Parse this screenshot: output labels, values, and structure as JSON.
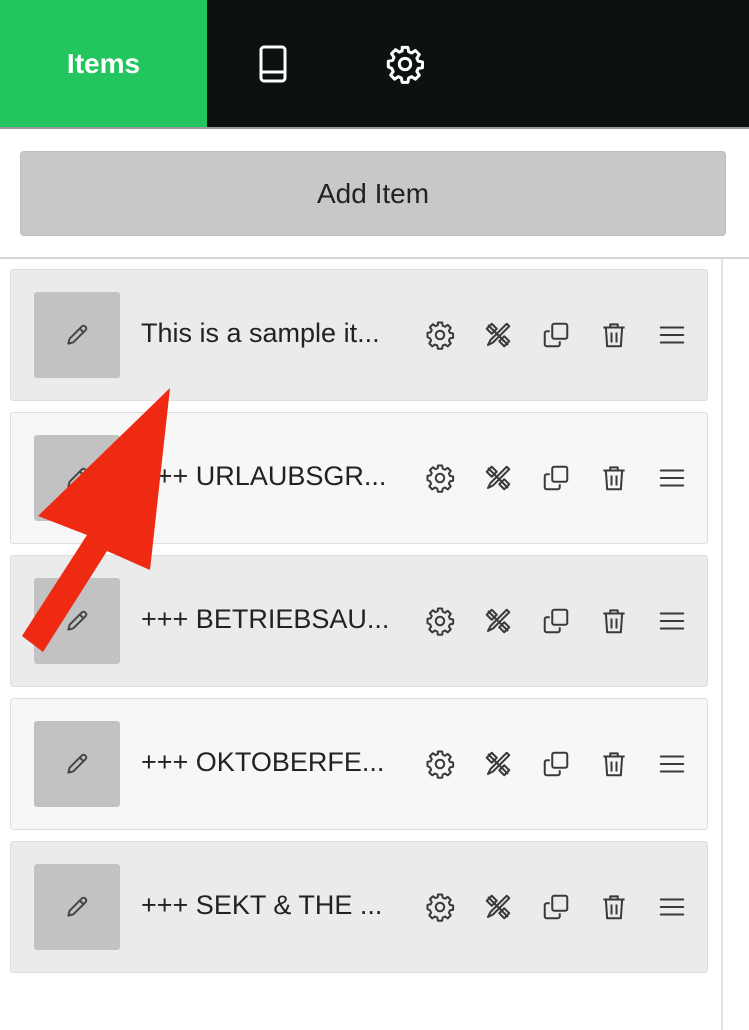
{
  "topbar": {
    "items_tab_label": "Items",
    "accent_color": "#22c55e",
    "icons": [
      "tablet-icon",
      "gear-icon"
    ]
  },
  "add_button": {
    "label": "Add Item"
  },
  "items": [
    {
      "title": "This is a sample it..."
    },
    {
      "title": "+++ URLAUBSGR..."
    },
    {
      "title": "+++ BETRIEBSAU..."
    },
    {
      "title": "+++ OKTOBERFE..."
    },
    {
      "title": "+++ SEKT & THE ..."
    }
  ],
  "item_action_icons": [
    "gear-icon",
    "design-tools-icon",
    "duplicate-icon",
    "trash-icon",
    "drag-handle-icon"
  ],
  "annotation": {
    "arrow_color": "#ee2a13"
  }
}
